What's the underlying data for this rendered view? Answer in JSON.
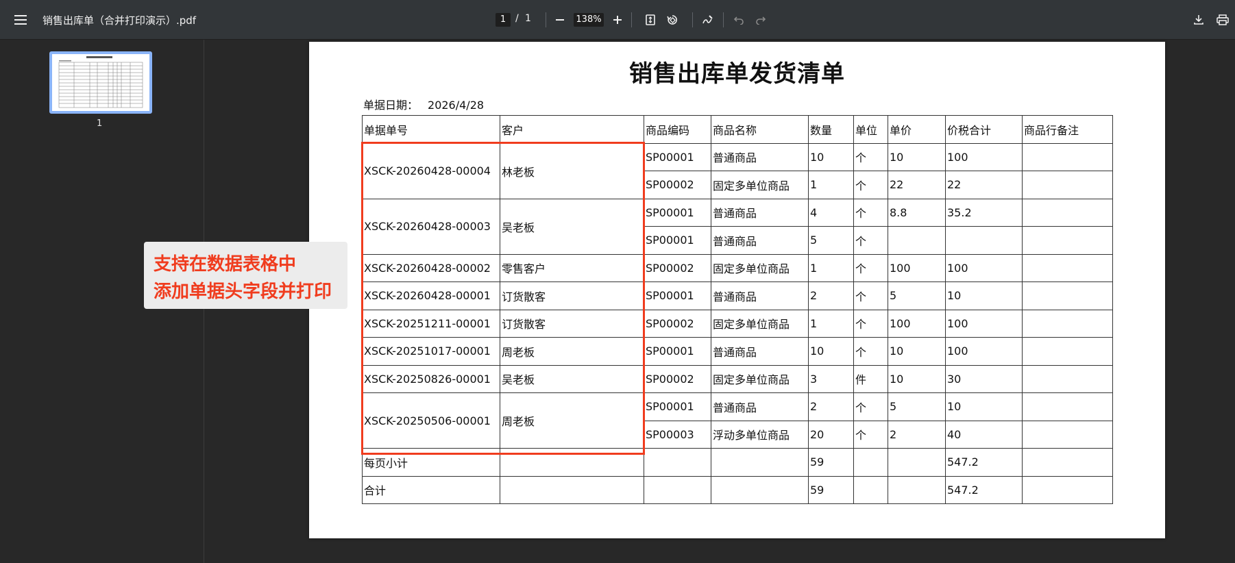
{
  "viewer": {
    "menu_icon": "≡",
    "title": "销售出库单（合并打印演示）.pdf",
    "page_current": "1",
    "page_sep": "/",
    "page_total": "1",
    "zoom_out_icon": "−",
    "zoom": "138%",
    "zoom_in_icon": "+",
    "fit_icon": "fit-page-icon",
    "rotate_icon": "rotate-icon",
    "annotate_icon": "draw-icon",
    "undo_icon": "undo-icon",
    "redo_icon": "redo-icon",
    "download_icon": "download-icon",
    "print_icon": "print-icon",
    "thumb_label": "1"
  },
  "document": {
    "title": "销售出库单发货清单",
    "date_label": "单据日期：",
    "date_value": "2026/4/28",
    "headers": [
      "单据单号",
      "客户",
      "商品编码",
      "商品名称",
      "数量",
      "单位",
      "单价",
      "价税合计",
      "商品行备注"
    ],
    "orders": [
      {
        "no": "XSCK-20260428-00004",
        "customer": "林老板",
        "lines": [
          {
            "code": "SP00001",
            "name": "普通商品",
            "qty": "10",
            "unit": "个",
            "price": "10",
            "total": "100",
            "note": ""
          },
          {
            "code": "SP00002",
            "name": "固定多单位商品",
            "qty": "1",
            "unit": "个",
            "price": "22",
            "total": "22",
            "note": ""
          }
        ]
      },
      {
        "no": "XSCK-20260428-00003",
        "customer": "吴老板",
        "lines": [
          {
            "code": "SP00001",
            "name": "普通商品",
            "qty": "4",
            "unit": "个",
            "price": "8.8",
            "total": "35.2",
            "note": ""
          },
          {
            "code": "SP00001",
            "name": "普通商品",
            "qty": "5",
            "unit": "个",
            "price": "",
            "total": "",
            "note": ""
          }
        ]
      },
      {
        "no": "XSCK-20260428-00002",
        "customer": "零售客户",
        "lines": [
          {
            "code": "SP00002",
            "name": "固定多单位商品",
            "qty": "1",
            "unit": "个",
            "price": "100",
            "total": "100",
            "note": ""
          }
        ]
      },
      {
        "no": "XSCK-20260428-00001",
        "customer": "订货散客",
        "lines": [
          {
            "code": "SP00001",
            "name": "普通商品",
            "qty": "2",
            "unit": "个",
            "price": "5",
            "total": "10",
            "note": ""
          }
        ]
      },
      {
        "no": "XSCK-20251211-00001",
        "customer": "订货散客",
        "lines": [
          {
            "code": "SP00002",
            "name": "固定多单位商品",
            "qty": "1",
            "unit": "个",
            "price": "100",
            "total": "100",
            "note": ""
          }
        ]
      },
      {
        "no": "XSCK-20251017-00001",
        "customer": "周老板",
        "lines": [
          {
            "code": "SP00001",
            "name": "普通商品",
            "qty": "10",
            "unit": "个",
            "price": "10",
            "total": "100",
            "note": ""
          }
        ]
      },
      {
        "no": "XSCK-20250826-00001",
        "customer": "吴老板",
        "lines": [
          {
            "code": "SP00002",
            "name": "固定多单位商品",
            "qty": "3",
            "unit": "件",
            "price": "10",
            "total": "30",
            "note": ""
          }
        ]
      },
      {
        "no": "XSCK-20250506-00001",
        "customer": "周老板",
        "lines": [
          {
            "code": "SP00001",
            "name": "普通商品",
            "qty": "2",
            "unit": "个",
            "price": "5",
            "total": "10",
            "note": ""
          },
          {
            "code": "SP00003",
            "name": "浮动多单位商品",
            "qty": "20",
            "unit": "个",
            "price": "2",
            "total": "40",
            "note": ""
          }
        ]
      }
    ],
    "subtotal": {
      "label": "每页小计",
      "qty": "59",
      "total": "547.2"
    },
    "grand_total": {
      "label": "合计",
      "qty": "59",
      "total": "547.2"
    }
  },
  "callout": {
    "line1": "支持在数据表格中",
    "line2": "添加单据头字段并打印"
  },
  "colors": {
    "highlight": "#f03c1e",
    "toolbar": "#323639",
    "background": "#282828"
  }
}
